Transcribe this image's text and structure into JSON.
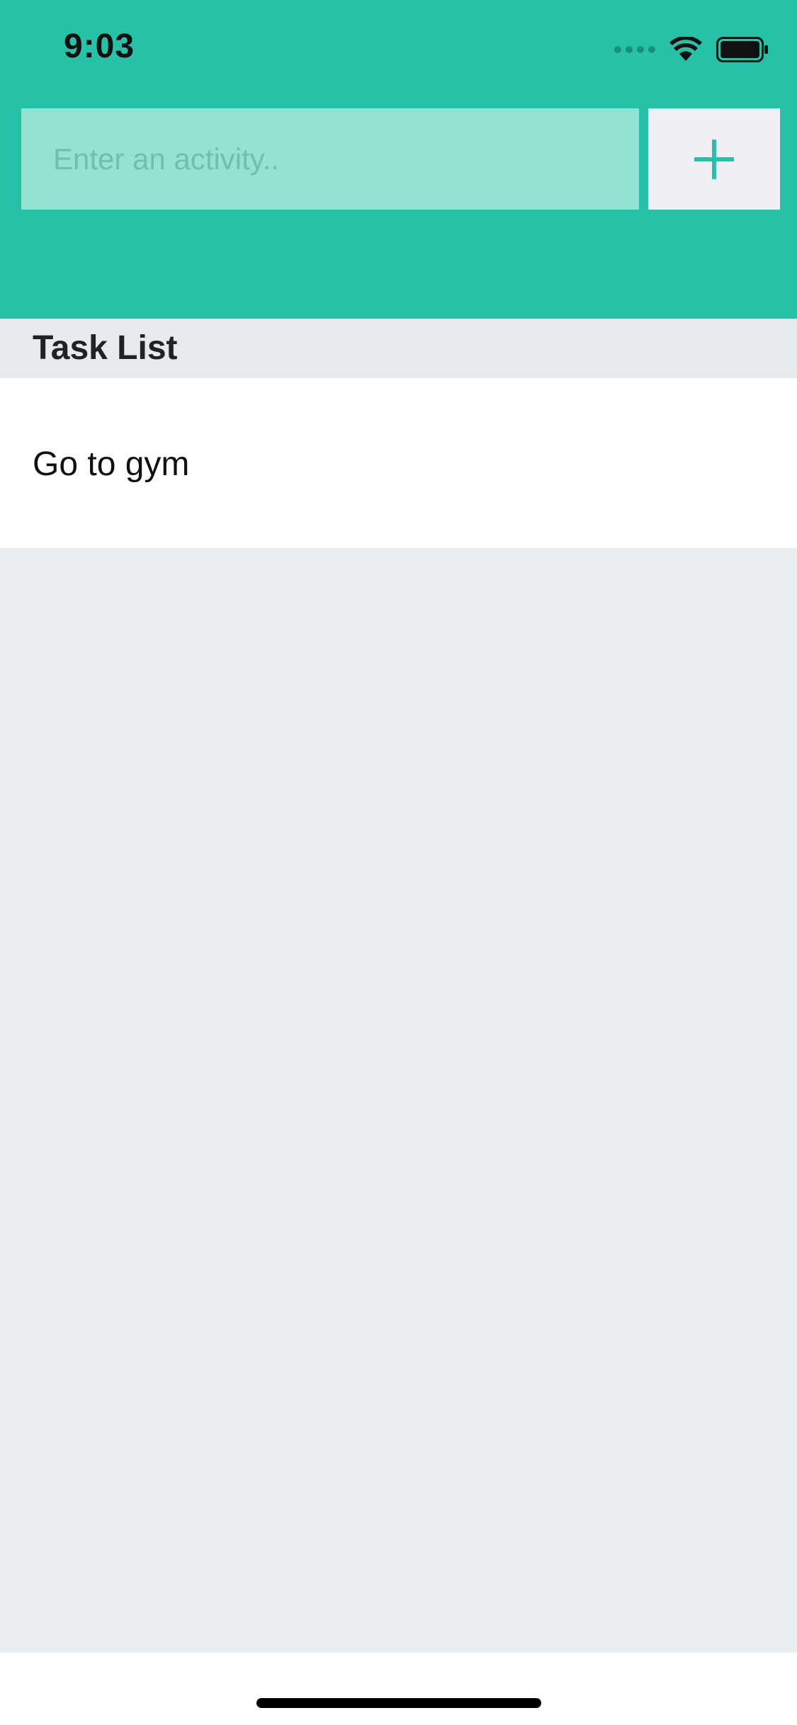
{
  "status_bar": {
    "time": "9:03",
    "icons": [
      "cellular-signal-icon",
      "wifi-icon",
      "battery-icon"
    ]
  },
  "colors": {
    "accent": "#27c1a8",
    "input_background": "#93e3d5",
    "add_button_background": "#efeff4",
    "add_button_glyph": "#27c1a8",
    "section_header_background": "#e8e9eb",
    "list_background": "#ebeef1"
  },
  "activity_input": {
    "placeholder": "Enter an activity..",
    "value": ""
  },
  "add_button": {
    "icon": "plus-icon"
  },
  "section": {
    "title": "Task List"
  },
  "tasks": [
    {
      "label": "Go to gym"
    }
  ]
}
